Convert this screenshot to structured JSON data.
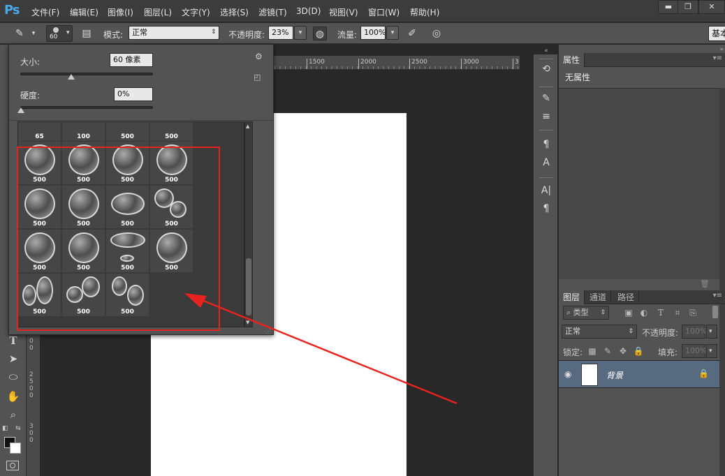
{
  "app": {
    "logo": "Ps"
  },
  "menu": [
    {
      "label": "文件(F)"
    },
    {
      "label": "编辑(E)"
    },
    {
      "label": "图像(I)"
    },
    {
      "label": "图层(L)"
    },
    {
      "label": "文字(Y)"
    },
    {
      "label": "选择(S)"
    },
    {
      "label": "滤镜(T)"
    },
    {
      "label": "3D(D)"
    },
    {
      "label": "视图(V)"
    },
    {
      "label": "窗口(W)"
    },
    {
      "label": "帮助(H)"
    }
  ],
  "window_controls": {
    "minimize": "▬",
    "restore": "❐",
    "close": "✕"
  },
  "options": {
    "brush_size_value": "60",
    "mode_label": "模式:",
    "mode_value": "正常",
    "opacity_label": "不透明度:",
    "opacity_value": "23%",
    "flow_label": "流量:",
    "flow_value": "100%",
    "workspace": "基本"
  },
  "brush_popup": {
    "size_label": "大小:",
    "size_value": "60 像素",
    "size_level": 0.38,
    "hardness_label": "硬度:",
    "hardness_value": "0%",
    "hardness_level": 0.0,
    "top_row_sizes": [
      "65",
      "100",
      "500",
      "500"
    ],
    "brushes": [
      {
        "size": "500"
      },
      {
        "size": "500"
      },
      {
        "size": "500"
      },
      {
        "size": "500"
      },
      {
        "size": "500"
      },
      {
        "size": "500"
      },
      {
        "size": "500"
      },
      {
        "size": "500"
      },
      {
        "size": "500"
      },
      {
        "size": "500"
      },
      {
        "size": "500"
      },
      {
        "size": "500"
      },
      {
        "size": "500"
      },
      {
        "size": "500"
      },
      {
        "size": "500"
      }
    ]
  },
  "ruler": {
    "h_ticks": [
      "1500",
      "2000",
      "2500",
      "3000",
      "3"
    ],
    "v_digits": [
      "0",
      "0",
      "2",
      "5",
      "0",
      "0",
      "3",
      "0",
      "0"
    ]
  },
  "properties_panel": {
    "tab": "属性",
    "content": "无属性"
  },
  "layers_panel": {
    "tabs": [
      "图层",
      "通道",
      "路径"
    ],
    "filter_label": "类型",
    "blend_mode": "正常",
    "opacity_label": "不透明度:",
    "opacity_value": "100%",
    "lock_label": "锁定:",
    "fill_label": "填充:",
    "fill_value": "100%",
    "layers": [
      {
        "name": "背景"
      }
    ]
  },
  "colors": {
    "annotation_red": "#e8231e",
    "selected_layer": "#586a80",
    "ps_blue": "#4aa8e8"
  }
}
